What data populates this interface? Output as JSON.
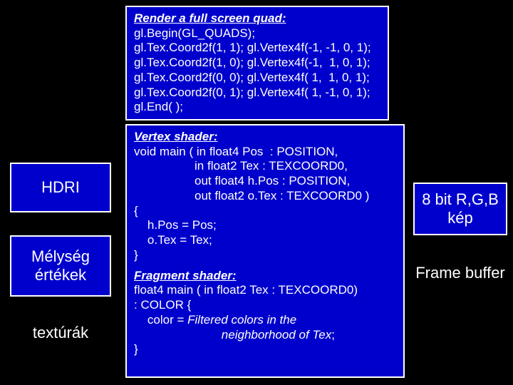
{
  "left": {
    "hdri": "HDRI",
    "melyseg": "Mélység\nértékek",
    "texturak": "textúrák"
  },
  "top": {
    "heading": "Render a full screen quad:",
    "code": "gl.Begin(GL_QUADS);\ngl.Tex.Coord2f(1, 1); gl.Vertex4f(-1, -1, 0, 1);\ngl.Tex.Coord2f(1, 0); gl.Vertex4f(-1,  1, 0, 1);\ngl.Tex.Coord2f(0, 0); gl.Vertex4f( 1,  1, 0, 1);\ngl.Tex.Coord2f(0, 1); gl.Vertex4f( 1, -1, 0, 1);\ngl.End( );"
  },
  "vertex": {
    "heading": "Vertex shader:",
    "code": "void main ( in float4 Pos  : POSITION,\n                  in float2 Tex : TEXCOORD0,\n                  out float4 h.Pos : POSITION,\n                  out float2 o.Tex : TEXCOORD0 )\n{\n    h.Pos = Pos;\n    o.Tex = Tex;\n}"
  },
  "fragment": {
    "heading": "Fragment shader:",
    "sig": "float4 main ( in float2 Tex : TEXCOORD0)\n: COLOR {",
    "body_pre": "    color = ",
    "body_italic": "Filtered colors in the\n                          neighborhood of Tex",
    "body_post": ";\n}"
  },
  "right": {
    "rgb": "8 bit R,G,B\nkép",
    "framebuffer": "Frame buffer"
  }
}
